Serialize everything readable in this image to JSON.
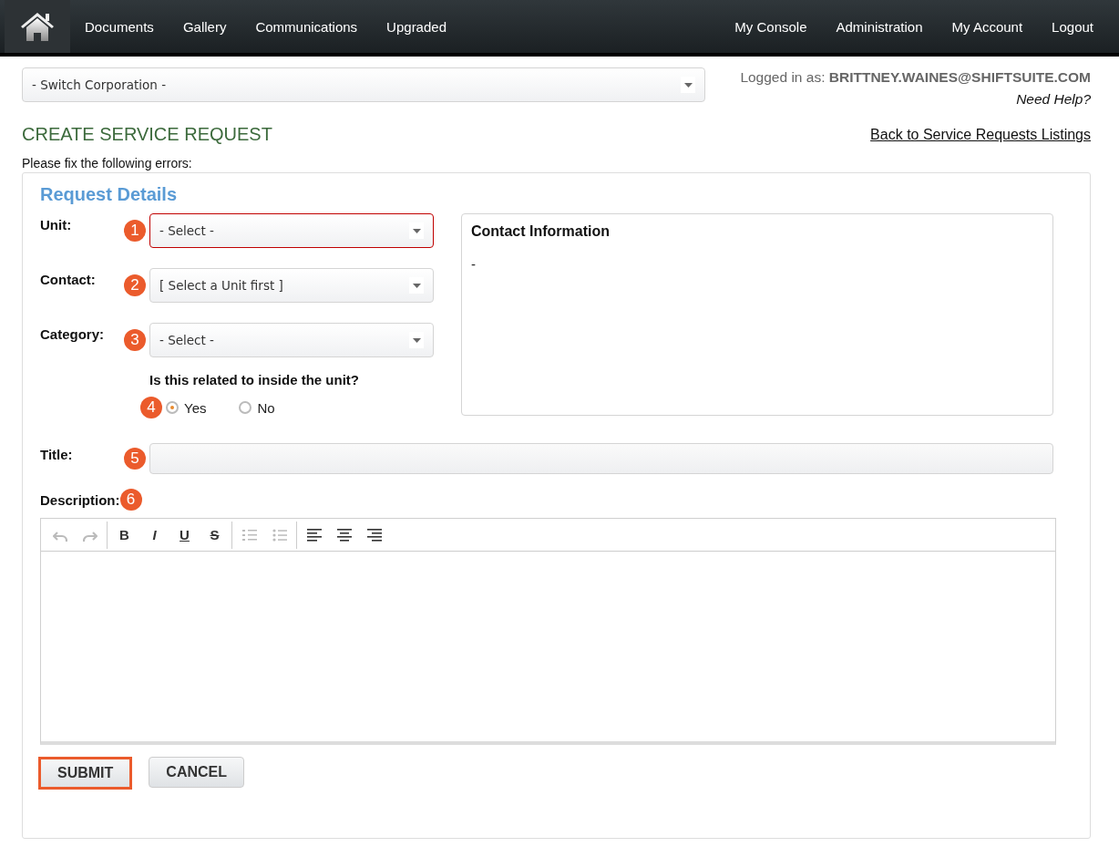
{
  "nav": {
    "left": [
      "Documents",
      "Gallery",
      "Communications",
      "Upgraded"
    ],
    "right": [
      "My Console",
      "Administration",
      "My Account",
      "Logout"
    ]
  },
  "company_select": {
    "value": "- Switch Corporation -"
  },
  "login": {
    "label": "Logged in as:",
    "user": "BRITTNEY.WAINES@SHIFTSUITE.COM",
    "help": "Need Help?"
  },
  "page_title": "CREATE SERVICE REQUEST",
  "back_link": "Back to Service Requests Listings",
  "error_message": "Please fix the following errors:",
  "panel": {
    "title": "Request Details",
    "fields": [
      {
        "label": "Unit:",
        "marker": "1",
        "value": "- Select -",
        "error": true
      },
      {
        "label": "Contact:",
        "marker": "2",
        "value": "[ Select a Unit first ]",
        "error": false
      },
      {
        "label": "Category:",
        "marker": "3",
        "value": "- Select -",
        "error": false
      }
    ],
    "question": {
      "text": "Is this related to inside the unit?",
      "marker": "4",
      "options": [
        {
          "label": "Yes",
          "selected": true
        },
        {
          "label": "No",
          "selected": false
        }
      ]
    },
    "contact_info": {
      "title": "Contact Information",
      "value": "-"
    },
    "title_field": {
      "label": "Title:",
      "marker": "5"
    },
    "description": {
      "label": "Description:",
      "marker": "6",
      "toolbar": [
        {
          "kind": "undo",
          "disabled": true
        },
        {
          "kind": "redo",
          "disabled": true
        },
        {
          "kind": "sep"
        },
        {
          "kind": "bold",
          "text": "B",
          "disabled": false
        },
        {
          "kind": "italic",
          "text": "I",
          "disabled": false
        },
        {
          "kind": "underline",
          "text": "U",
          "disabled": false
        },
        {
          "kind": "strike",
          "text": "S",
          "disabled": false
        },
        {
          "kind": "sep"
        },
        {
          "kind": "ordered-list",
          "disabled": true
        },
        {
          "kind": "bullet-list",
          "disabled": true
        },
        {
          "kind": "sep"
        },
        {
          "kind": "align-left",
          "disabled": false
        },
        {
          "kind": "align-center",
          "disabled": false
        },
        {
          "kind": "align-right",
          "disabled": false
        }
      ]
    },
    "buttons": [
      {
        "label": "SUBMIT",
        "highlighted": true
      },
      {
        "label": "CANCEL",
        "highlighted": false
      }
    ]
  }
}
